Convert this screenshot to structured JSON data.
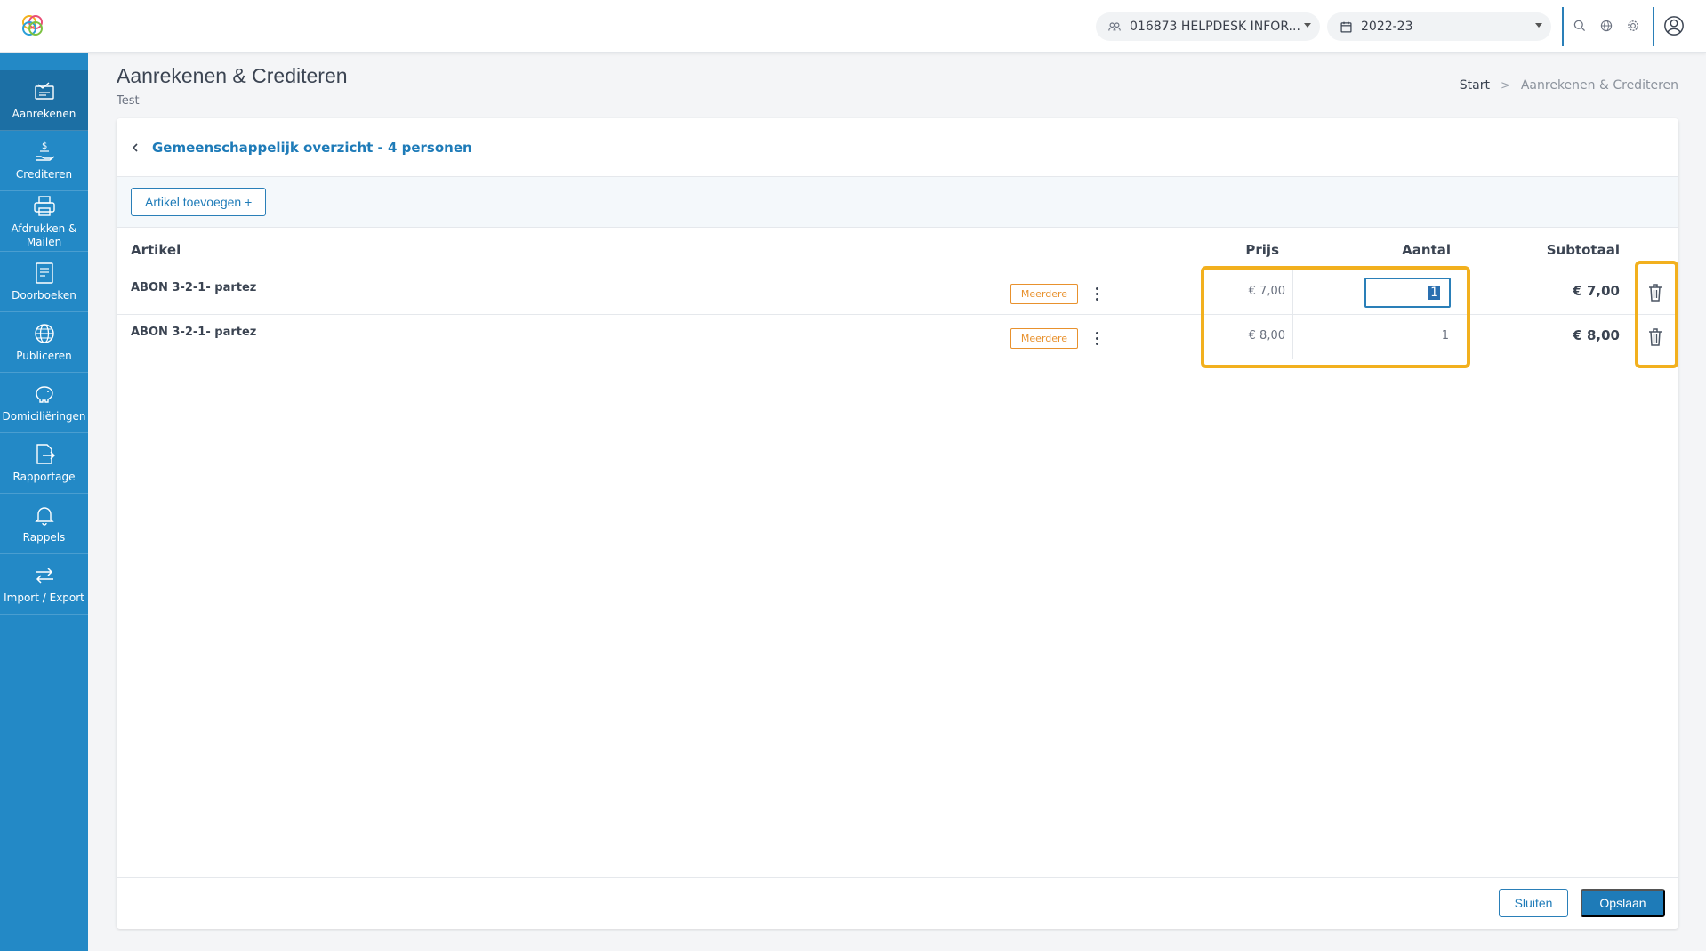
{
  "topbar": {
    "organisation": "016873 HELPDESK INFOR...",
    "school_year": "2022-23"
  },
  "sidebar": {
    "items": [
      {
        "label": "Aanrekenen",
        "icon": "invoice-icon",
        "active": true
      },
      {
        "label": "Crediteren",
        "icon": "hand-coin-icon",
        "active": false
      },
      {
        "label": "Afdrukken & Mailen",
        "icon": "printer-icon",
        "active": false
      },
      {
        "label": "Doorboeken",
        "icon": "ledger-book-icon",
        "active": false
      },
      {
        "label": "Publiceren",
        "icon": "globe-icon",
        "active": false
      },
      {
        "label": "Domiciliëringen",
        "icon": "piggy-bank-icon",
        "active": false
      },
      {
        "label": "Rapportage",
        "icon": "report-export-icon",
        "active": false
      },
      {
        "label": "Rappels",
        "icon": "bell-icon",
        "active": false
      },
      {
        "label": "Import / Export",
        "icon": "swap-arrows-icon",
        "active": false
      }
    ]
  },
  "page": {
    "title": "Aanrekenen & Crediteren",
    "subtitle": "Test",
    "breadcrumb": {
      "start": "Start",
      "separator": ">",
      "current": "Aanrekenen & Crediteren"
    }
  },
  "card": {
    "header_title": "Gemeenschappelijk overzicht - 4 personen",
    "add_article_label": "Artikel toevoegen +",
    "columns": {
      "article": "Artikel",
      "price": "Prijs",
      "quantity": "Aantal",
      "subtotal": "Subtotaal"
    },
    "rows": [
      {
        "article": "ABON 3-2-1- partez",
        "badge": "Meerdere",
        "price": "€ 7,00",
        "quantity": "1",
        "subtotal": "€ 7,00",
        "editing": true
      },
      {
        "article": "ABON 3-2-1- partez",
        "badge": "Meerdere",
        "price": "€ 8,00",
        "quantity": "1",
        "subtotal": "€ 8,00",
        "editing": false
      }
    ],
    "close_label": "Sluiten",
    "save_label": "Opslaan"
  },
  "colors": {
    "sidebar": "#2389c6",
    "sidebar_active": "#1c6fa4",
    "accent": "#1e7bb8",
    "badge": "#e8912d",
    "highlight": "#f2b01e"
  }
}
